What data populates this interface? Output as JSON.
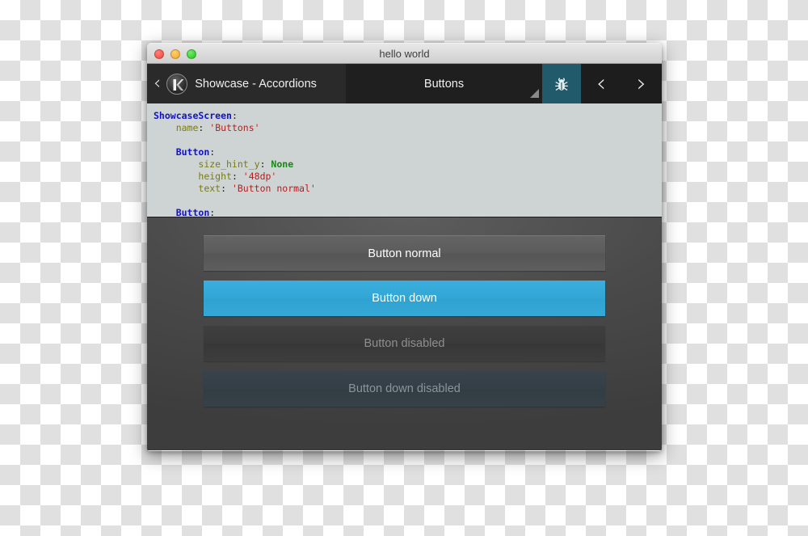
{
  "window": {
    "title": "hello world",
    "controls": [
      {
        "name": "close",
        "color": "#f4443c"
      },
      {
        "name": "minimize",
        "color": "#f5a623"
      },
      {
        "name": "zoom",
        "color": "#1fc718"
      }
    ]
  },
  "toolbar": {
    "back_chevron": "‹",
    "logo_icon": "kivy-logo-icon",
    "left_label": "Showcase - Accordions",
    "tab_label": "Buttons",
    "resize_grip": "resize-grip-icon",
    "bug_icon": "bug-icon",
    "bug_tab_color": "#215b6b",
    "prev_chevron": "‹",
    "next_chevron": "›"
  },
  "code": {
    "language": "kv",
    "lines": [
      {
        "indent": 0,
        "tokens": [
          {
            "t": "class",
            "v": "ShowcaseScreen"
          },
          {
            "t": "punc",
            "v": ":"
          }
        ]
      },
      {
        "indent": 1,
        "tokens": [
          {
            "t": "prop",
            "v": "name"
          },
          {
            "t": "punc",
            "v": ": "
          },
          {
            "t": "str",
            "v": "'Buttons'"
          }
        ]
      },
      {
        "indent": 0,
        "tokens": []
      },
      {
        "indent": 1,
        "tokens": [
          {
            "t": "class",
            "v": "Button"
          },
          {
            "t": "punc",
            "v": ":"
          }
        ]
      },
      {
        "indent": 2,
        "tokens": [
          {
            "t": "prop",
            "v": "size_hint_y"
          },
          {
            "t": "punc",
            "v": ": "
          },
          {
            "t": "kw",
            "v": "None"
          }
        ]
      },
      {
        "indent": 2,
        "tokens": [
          {
            "t": "prop",
            "v": "height"
          },
          {
            "t": "punc",
            "v": ": "
          },
          {
            "t": "str",
            "v": "'48dp'"
          }
        ]
      },
      {
        "indent": 2,
        "tokens": [
          {
            "t": "prop",
            "v": "text"
          },
          {
            "t": "punc",
            "v": ": "
          },
          {
            "t": "str",
            "v": "'Button normal'"
          }
        ]
      },
      {
        "indent": 0,
        "tokens": []
      },
      {
        "indent": 1,
        "tokens": [
          {
            "t": "class",
            "v": "Button"
          },
          {
            "t": "punc",
            "v": ":"
          }
        ]
      }
    ]
  },
  "demo": {
    "buttons": [
      {
        "label": "Button normal",
        "state": "normal",
        "color": "#5c5c5c",
        "text_color": "#ffffff"
      },
      {
        "label": "Button down",
        "state": "down",
        "color": "#32a6d5",
        "text_color": "#ffffff"
      },
      {
        "label": "Button disabled",
        "state": "disabled",
        "color": "#3a3a3a",
        "text_color": "#8e8e8e"
      },
      {
        "label": "Button down disabled",
        "state": "down-disabled",
        "color": "#343e46",
        "text_color": "#8b949a"
      }
    ]
  }
}
